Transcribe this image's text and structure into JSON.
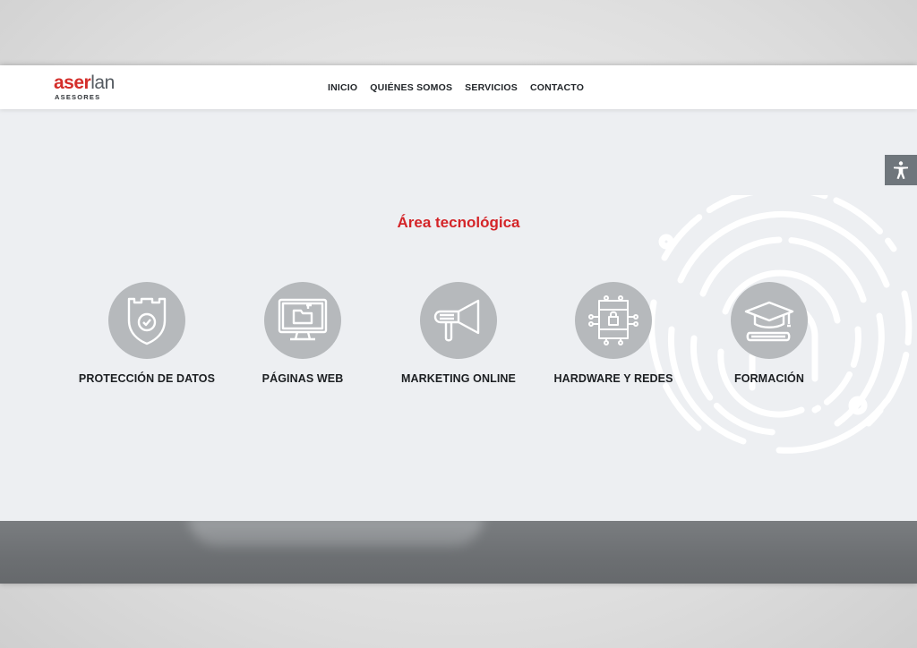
{
  "header": {
    "logo": {
      "main": "aser",
      "accent": "lan",
      "sub": "ASESORES"
    },
    "nav": [
      {
        "label": "INICIO"
      },
      {
        "label": "QUIÉNES SOMOS"
      },
      {
        "label": "SERVICIOS"
      },
      {
        "label": "CONTACTO"
      }
    ]
  },
  "section": {
    "title": "Área tecnológica"
  },
  "services": [
    {
      "label": "PROTECCIÓN DE DATOS",
      "icon": "shield-castle-icon"
    },
    {
      "label": "PÁGINAS WEB",
      "icon": "monitor-icon"
    },
    {
      "label": "MARKETING ONLINE",
      "icon": "megaphone-icon"
    },
    {
      "label": "HARDWARE Y REDES",
      "icon": "network-lock-icon"
    },
    {
      "label": "FORMACIÓN",
      "icon": "graduation-cap-icon"
    }
  ],
  "accessibility": {
    "icon": "accessibility-icon"
  },
  "colors": {
    "brand_red": "#d42428",
    "icon_circle": "#b6b9bc",
    "page_bg": "#edeff2"
  }
}
